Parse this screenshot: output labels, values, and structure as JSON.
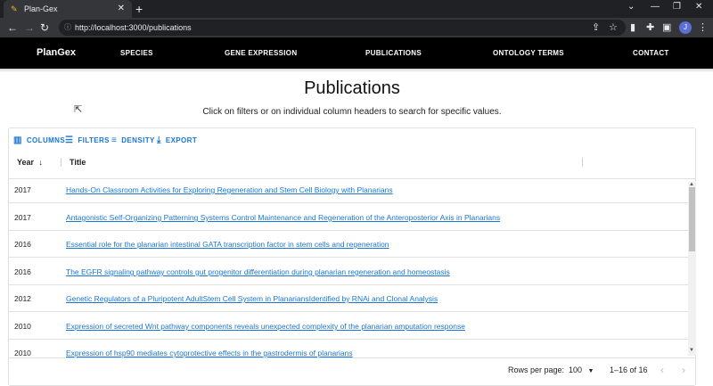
{
  "browser": {
    "tab_title": "Plan-Gex",
    "url": "http://localhost:3000/publications",
    "profile_initial": "J"
  },
  "nav": {
    "brand": "PlanGex",
    "links": [
      "SPECIES",
      "GENE EXPRESSION",
      "PUBLICATIONS",
      "ONTOLOGY TERMS",
      "CONTACT"
    ]
  },
  "page": {
    "title": "Publications",
    "subtitle": "Click on filters or on individual column headers to search for specific values."
  },
  "grid": {
    "toolbar": [
      "COLUMNS",
      "FILTERS",
      "DENSITY",
      "EXPORT"
    ],
    "columns": [
      "Year",
      "Title"
    ],
    "rows": [
      {
        "year": "2017",
        "title": "Hands-On Classroom Activities for Exploring Regeneration and Stem Cell Biology with Planarians"
      },
      {
        "year": "2017",
        "title": "Antagonistic Self-Organizing Patterning Systems Control Maintenance and Regeneration of the Anteroposterior Axis in Planarians"
      },
      {
        "year": "2016",
        "title": "Essential role for the planarian intestinal GATA transcription factor in stem cells and regeneration"
      },
      {
        "year": "2016",
        "title": "The EGFR signaling pathway controls gut progenitor differentiation during planarian regeneration and homeostasis"
      },
      {
        "year": "2012",
        "title": "Genetic Regulators of a Pluripotent AdultStem Cell System in PlanariansIdentified by RNAi and Clonal Analysis"
      },
      {
        "year": "2010",
        "title": "Expression of secreted Wnt pathway components reveals unexpected complexity of the planarian amputation response"
      },
      {
        "year": "2010",
        "title": "Expression of hsp90 mediates cytoprotective effects in the gastrodermis of planarians"
      }
    ],
    "footer": {
      "rows_per_page_label": "Rows per page:",
      "rows_per_page_value": "100",
      "range": "1–16 of 16"
    }
  },
  "colors": {
    "accent": "#1976d2",
    "nav_bg": "#000000"
  }
}
